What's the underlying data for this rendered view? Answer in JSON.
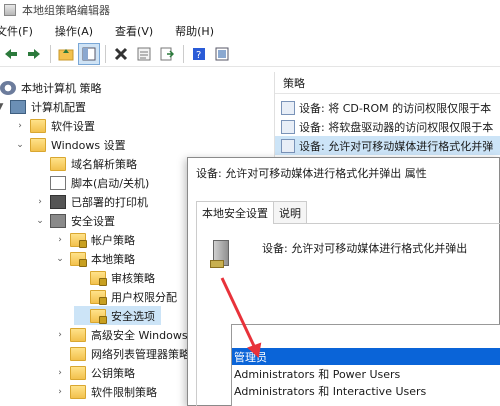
{
  "window": {
    "title": "本地组策略编辑器"
  },
  "menu": [
    "文件(F)",
    "操作(A)",
    "查看(V)",
    "帮助(H)"
  ],
  "toolbar": {
    "icons": [
      "back-arrow-icon",
      "forward-arrow-icon",
      "up-folder-icon",
      "show-hide-tree-icon",
      "delete-icon",
      "properties-icon",
      "export-list-icon",
      "help-icon",
      "view-icon"
    ]
  },
  "tree": [
    {
      "label": "本地计算机 策略",
      "icon": "gear-icon"
    },
    {
      "label": "计算机配置",
      "icon": "computer-icon",
      "expanded": true
    },
    {
      "label": "软件设置",
      "icon": "folder-icon"
    },
    {
      "label": "Windows 设置",
      "icon": "folder-icon",
      "expanded": true
    },
    {
      "label": "域名解析策略",
      "icon": "folder-icon"
    },
    {
      "label": "脚本(启动/关机)",
      "icon": "document-icon"
    },
    {
      "label": "已部署的打印机",
      "icon": "printer-icon"
    },
    {
      "label": "安全设置",
      "icon": "security-icon",
      "expanded": true
    },
    {
      "label": "帐户策略",
      "icon": "lock-folder-icon"
    },
    {
      "label": "本地策略",
      "icon": "lock-folder-icon",
      "expanded": true
    },
    {
      "label": "审核策略",
      "icon": "lock-folder-icon"
    },
    {
      "label": "用户权限分配",
      "icon": "lock-folder-icon"
    },
    {
      "label": "安全选项",
      "icon": "lock-folder-icon",
      "selected": true
    },
    {
      "label": "高级安全 Windows",
      "icon": "folder-icon"
    },
    {
      "label": "网络列表管理器策略",
      "icon": "folder-icon"
    },
    {
      "label": "公钥策略",
      "icon": "folder-icon"
    },
    {
      "label": "软件限制策略",
      "icon": "folder-icon"
    }
  ],
  "right": {
    "header": "策略",
    "policies": [
      "设备: 将 CD-ROM 的访问权限仅限于本",
      "设备: 将软盘驱动器的访问权限仅限于本",
      "设备: 允许对可移动媒体进行格式化并弹"
    ]
  },
  "dialog": {
    "title": "设备: 允许对可移动媒体进行格式化并弹出 属性",
    "tabs": [
      "本地安全设置",
      "说明"
    ],
    "policy_name": "设备: 允许对可移动媒体进行格式化并弹出",
    "options": [
      "管理员",
      "Administrators 和 Power Users",
      "Administrators 和 Interactive Users"
    ],
    "selected_option": "管理员"
  },
  "colors": {
    "selection": "#0a64d8",
    "annotation_arrow": "#e8323a",
    "selected_row": "#cce4f7"
  }
}
